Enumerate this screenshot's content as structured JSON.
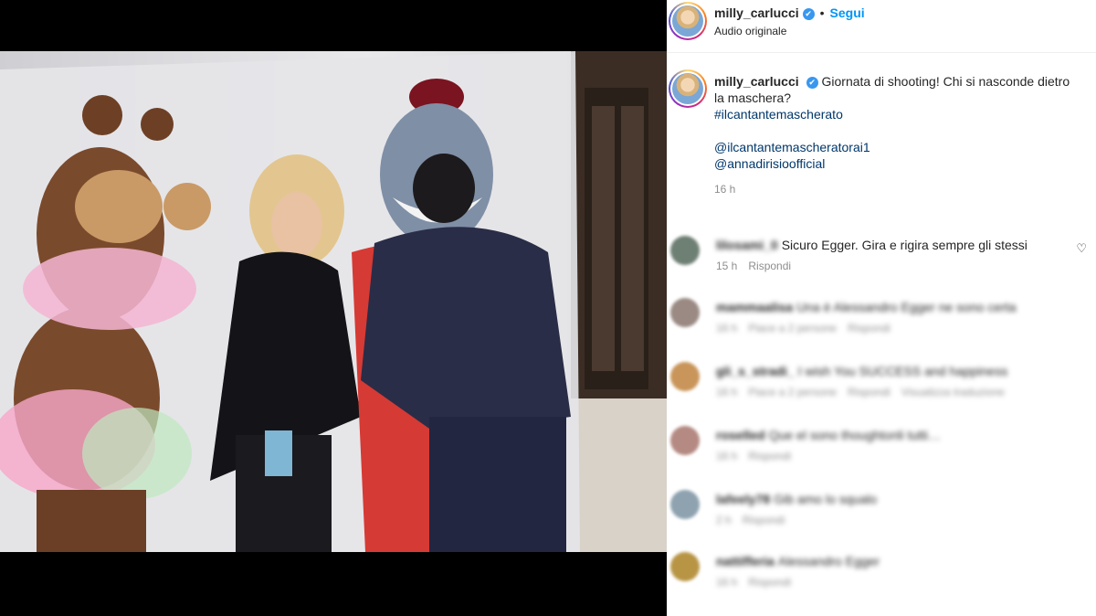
{
  "post": {
    "author": "milly_carlucci",
    "follow_label": "Segui",
    "separator": "•",
    "audio_label": "Audio originale",
    "verified_glyph": "✔",
    "caption": "Giornata di shooting! Chi si nasconde dietro la maschera?",
    "hashtag": "#ilcantantemascherato",
    "mention_1": "@ilcantantemascheratorai1",
    "mention_2": "@annadirisioofficial",
    "age": "16 h"
  },
  "comments": [
    {
      "user": "lilosami_0",
      "text": "Sicuro Egger. Gira e rigira sempre gli stessi",
      "time": "15 h",
      "likes": "",
      "reply": "Rispondi",
      "extra": "",
      "blurred": false,
      "avatar_color": "#6e7f74"
    },
    {
      "user": "mammaalisa",
      "text": "Una è Alessandro Egger ne sono certa",
      "time": "16 h",
      "likes": "Piace a 2 persone",
      "reply": "Rispondi",
      "extra": "",
      "blurred": true,
      "avatar_color": "#9a8a83"
    },
    {
      "user": "gli_s_stradi_",
      "text": "I wish You SUCCESS and happiness",
      "time": "16 h",
      "likes": "Piace a 2 persone",
      "reply": "Rispondi",
      "extra": "Visualizza traduzione",
      "blurred": true,
      "avatar_color": "#c9955a"
    },
    {
      "user": "roselled",
      "text": "Que el sono thoughtonli tutti…",
      "time": "16 h",
      "likes": "",
      "reply": "Rispondi",
      "extra": "",
      "blurred": true,
      "avatar_color": "#b58a82"
    },
    {
      "user": "lafeely78",
      "text": "Gib amo lo squalo",
      "time": "2 h",
      "likes": "",
      "reply": "Rispondi",
      "extra": "",
      "blurred": true,
      "avatar_color": "#8ea2b0"
    },
    {
      "user": "nattifferia",
      "text": "Alessandro Egger",
      "time": "16 h",
      "likes": "",
      "reply": "Rispondi",
      "extra": "",
      "blurred": true,
      "avatar_color": "#b89545"
    }
  ],
  "icons": {
    "heart": "heart-outline-icon"
  },
  "colors": {
    "accent": "#0095f6",
    "link": "#00376b",
    "muted": "#8e8e8e"
  }
}
